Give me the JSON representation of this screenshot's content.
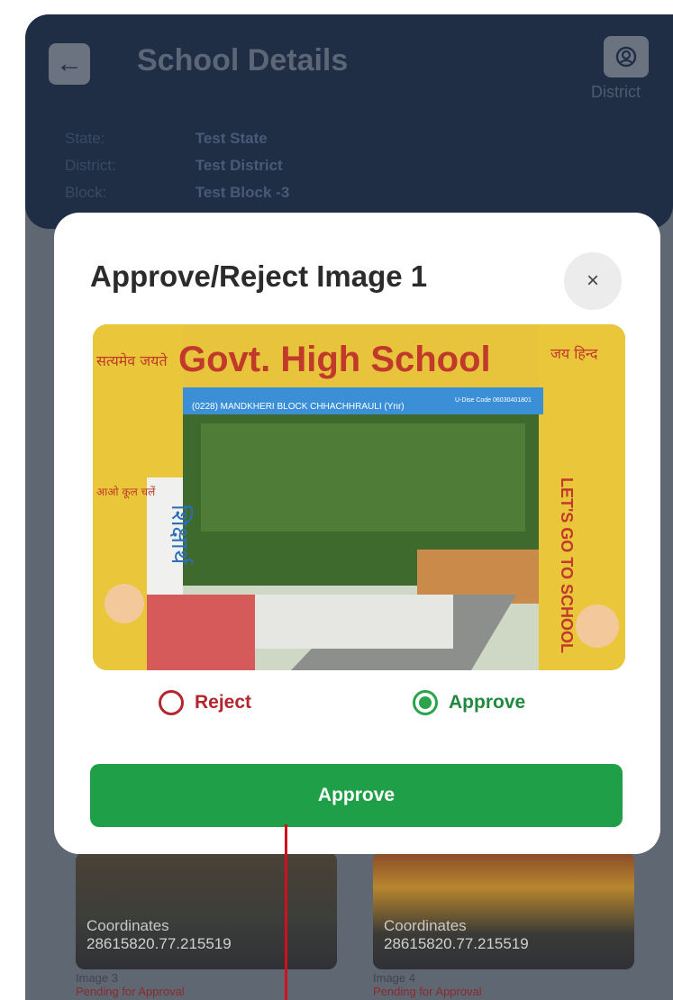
{
  "header": {
    "title": "School Details",
    "district_label": "District",
    "state_label": "State:",
    "state_value": "Test State",
    "district_field_label": "District:",
    "district_value": "Test District",
    "block_label": "Block:",
    "block_value": "Test Block -3"
  },
  "modal": {
    "title": "Approve/Reject Image 1",
    "close_label": "×",
    "image": {
      "sign_title": "Govt. High School",
      "sign_subtitle": "(0228) MANDKHERI BLOCK CHHACHHRAULI (Ynr)",
      "sign_code": "U-Dise Code 06030401801",
      "left_motto": "सत्यमेव जयते",
      "right_motto": "जय हिन्द",
      "left_pillar_big": "शिक्षार्थ",
      "left_pillar_small": "आओ कूल चलें",
      "right_pillar": "LET'S GO TO SCHOOL"
    },
    "reject_label": "Reject",
    "approve_option_label": "Approve",
    "selected": "approve",
    "approve_button_label": "Approve"
  },
  "cards": [
    {
      "coord_label": "Coordinates",
      "coord_value": "28615820.77.215519",
      "image_label": "Image 3",
      "status": "Pending for Approval"
    },
    {
      "coord_label": "Coordinates",
      "coord_value": "28615820.77.215519",
      "image_label": "Image 4",
      "status": "Pending for Approval"
    }
  ],
  "colors": {
    "header_bg": "#1f2d45",
    "approve_green": "#1fa048",
    "reject_red": "#b3262e",
    "annotation_red": "#d0101c"
  }
}
